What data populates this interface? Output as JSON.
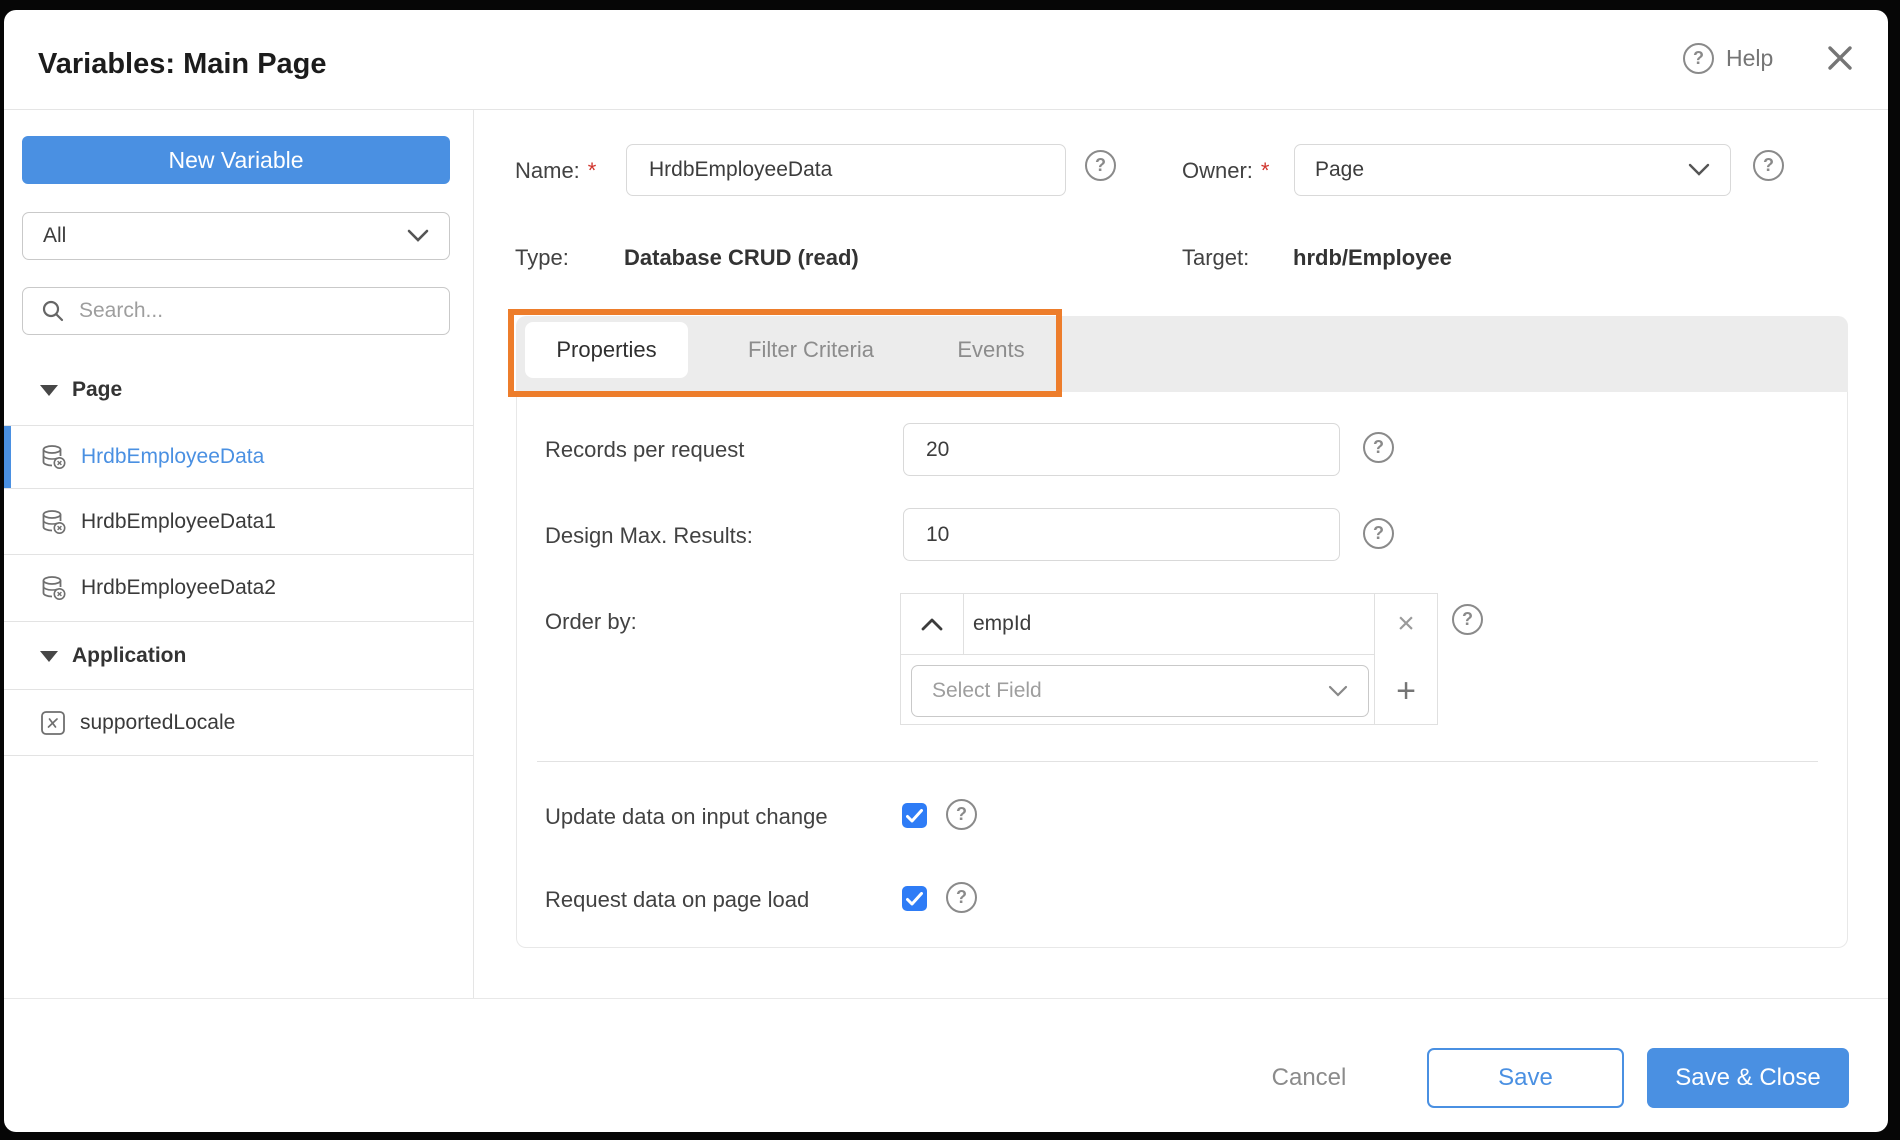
{
  "dialog": {
    "title": "Variables: Main Page",
    "help_label": "Help"
  },
  "icons": {
    "question": "?",
    "remove": "×",
    "add": "+"
  },
  "sidebar": {
    "new_variable_label": "New Variable",
    "filter_value": "All",
    "search_placeholder": "Search...",
    "sections": [
      {
        "label": "Page",
        "items": [
          {
            "label": "HrdbEmployeeData",
            "icon": "database-crud-icon",
            "selected": true
          },
          {
            "label": "HrdbEmployeeData1",
            "icon": "database-crud-icon",
            "selected": false
          },
          {
            "label": "HrdbEmployeeData2",
            "icon": "database-crud-icon",
            "selected": false
          }
        ]
      },
      {
        "label": "Application",
        "items": [
          {
            "label": "supportedLocale",
            "icon": "variable-icon",
            "selected": false
          }
        ]
      }
    ]
  },
  "form": {
    "required_mark": "*",
    "name": {
      "label": "Name:",
      "value": "HrdbEmployeeData"
    },
    "owner": {
      "label": "Owner:",
      "value": "Page"
    },
    "type": {
      "label": "Type:",
      "value": "Database CRUD (read)"
    },
    "target": {
      "label": "Target:",
      "value": "hrdb/Employee"
    }
  },
  "tabs": [
    {
      "label": "Properties",
      "active": true
    },
    {
      "label": "Filter Criteria",
      "active": false
    },
    {
      "label": "Events",
      "active": false
    }
  ],
  "properties": {
    "records_per_request": {
      "label": "Records per request",
      "value": "20"
    },
    "design_max_results": {
      "label": "Design Max. Results:",
      "value": "10"
    },
    "order_by": {
      "label": "Order by:",
      "field": "empId",
      "sort": "ascending",
      "select_placeholder": "Select Field"
    },
    "update_on_input_change": {
      "label": "Update data on input change",
      "checked": true
    },
    "request_on_page_load": {
      "label": "Request data on page load",
      "checked": true
    }
  },
  "footer": {
    "cancel_label": "Cancel",
    "save_label": "Save",
    "save_close_label": "Save & Close"
  },
  "colors": {
    "accent": "#4a90e2",
    "checkbox_blue": "#2e7cf6",
    "highlight_orange": "#ed7d2b"
  }
}
